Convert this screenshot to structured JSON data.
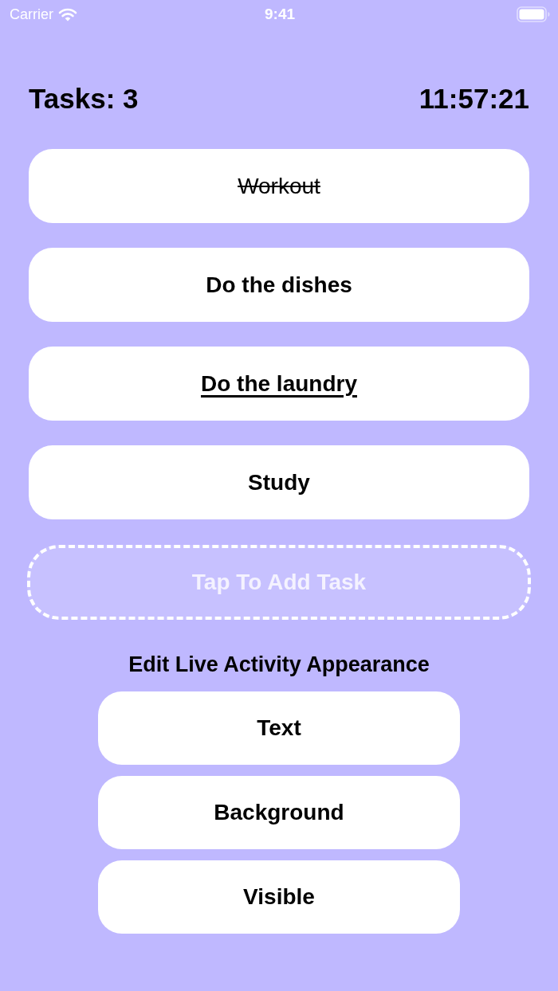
{
  "status_bar": {
    "carrier": "Carrier",
    "time": "9:41"
  },
  "header": {
    "task_count": "Tasks: 3",
    "clock": "11:57:21"
  },
  "tasks": [
    {
      "label": "Workout",
      "done": true,
      "selected": false
    },
    {
      "label": "Do the dishes",
      "done": false,
      "selected": false
    },
    {
      "label": "Do the laundry",
      "done": false,
      "selected": true
    },
    {
      "label": "Study",
      "done": false,
      "selected": false
    }
  ],
  "add_task": {
    "label": "Tap To Add Task"
  },
  "appearance": {
    "title": "Edit Live Activity Appearance",
    "buttons": [
      {
        "label": "Text"
      },
      {
        "label": "Background"
      },
      {
        "label": "Visible"
      }
    ]
  }
}
